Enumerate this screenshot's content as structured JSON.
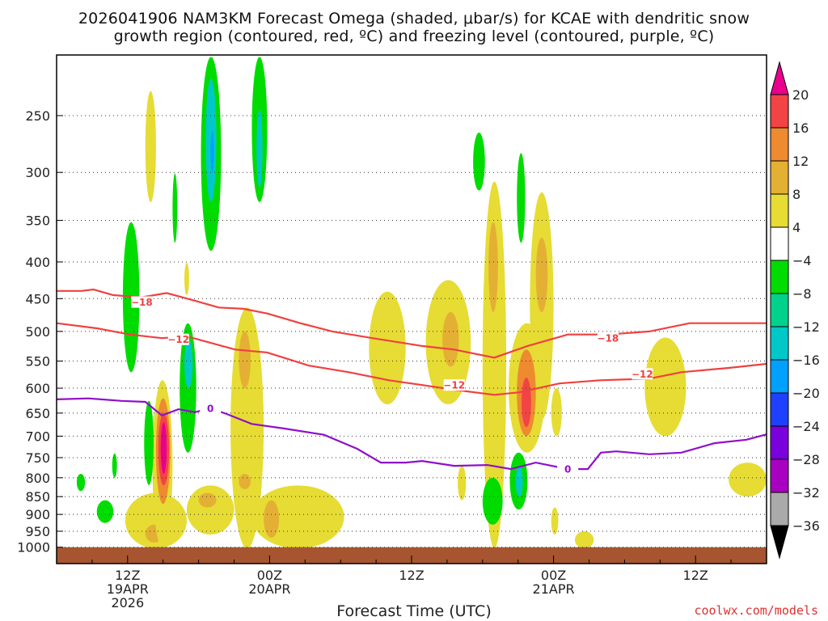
{
  "chart_data": {
    "type": "heatmap",
    "title_line1": "2026041906 NAM3KM Forecast Omega (shaded, μbar/s) for KCAE with dendritic snow",
    "title_line2": "growth region (contoured, red, ºC) and freezing level (contoured, purple, ºC)",
    "xlabel": "Forecast Time (UTC)",
    "ylabel": "",
    "xlim_hours": [
      0,
      60
    ],
    "ylim_hPa": [
      1050,
      205
    ],
    "y_ticks": [
      250,
      300,
      350,
      400,
      450,
      500,
      550,
      600,
      650,
      700,
      750,
      800,
      850,
      900,
      950,
      1000
    ],
    "x_ticks": [
      {
        "hour": 6,
        "lines": [
          "12Z",
          "19APR",
          "2026"
        ]
      },
      {
        "hour": 18,
        "lines": [
          "00Z",
          "20APR"
        ]
      },
      {
        "hour": 30,
        "lines": [
          "12Z"
        ]
      },
      {
        "hour": 42,
        "lines": [
          "00Z",
          "21APR"
        ]
      },
      {
        "hour": 54,
        "lines": [
          "12Z"
        ]
      }
    ],
    "grid": "horizontal dotted",
    "colorbar": {
      "labels": [
        "20",
        "16",
        "12",
        "8",
        "4",
        "−4",
        "−8",
        "−12",
        "−16",
        "−20",
        "−24",
        "−28",
        "−32",
        "−36"
      ],
      "levels": [
        20,
        16,
        12,
        8,
        4,
        -4,
        -8,
        -12,
        -16,
        -20,
        -24,
        -28,
        -32,
        -36
      ],
      "colors": [
        "#f24444",
        "#ee8a30",
        "#e4b034",
        "#e6dc34",
        "#ffffff",
        "#00dc00",
        "#00d28c",
        "#00c8c8",
        "#00a0ff",
        "#1e40ff",
        "#7a00dc",
        "#a800c0",
        "#aaaaaa"
      ],
      "over_color": "#e8008c",
      "under_color": "#000000"
    },
    "omega_blobs_hour_hPa_value": [
      [
        7.5,
        8.4,
        231,
        330,
        6
      ],
      [
        12.2,
        13.9,
        207,
        386,
        -6
      ],
      [
        12.6,
        13.5,
        222,
        330,
        -14
      ],
      [
        13.0,
        13.3,
        262,
        300,
        -18
      ],
      [
        16.5,
        17.8,
        207,
        330,
        -6
      ],
      [
        16.9,
        17.4,
        245,
        315,
        -12
      ],
      [
        9.8,
        10.2,
        301,
        376,
        -6
      ],
      [
        5.6,
        7.0,
        352,
        570,
        -6
      ],
      [
        10.8,
        11.2,
        401,
        445,
        6
      ],
      [
        10.4,
        11.8,
        487,
        738,
        -6
      ],
      [
        10.8,
        11.5,
        513,
        600,
        -14
      ],
      [
        14.7,
        17.5,
        463,
        1004,
        6
      ],
      [
        15.4,
        16.4,
        500,
        600,
        10
      ],
      [
        15.4,
        16.4,
        790,
        830,
        10
      ],
      [
        11.0,
        15.0,
        820,
        960,
        6
      ],
      [
        12.0,
        13.5,
        840,
        880,
        10
      ],
      [
        5.8,
        11.0,
        840,
        1004,
        6
      ],
      [
        7.5,
        9.0,
        930,
        985,
        10
      ],
      [
        16.5,
        24.3,
        820,
        1004,
        6
      ],
      [
        17.5,
        18.8,
        860,
        970,
        10
      ],
      [
        8.1,
        9.8,
        585,
        1004,
        6
      ],
      [
        8.4,
        9.6,
        620,
        870,
        14
      ],
      [
        8.6,
        9.5,
        650,
        820,
        18
      ],
      [
        8.8,
        9.3,
        670,
        790,
        22
      ],
      [
        7.4,
        8.2,
        625,
        819,
        -6
      ],
      [
        26.4,
        29.5,
        440,
        632,
        6
      ],
      [
        31.2,
        35.0,
        424,
        632,
        6
      ],
      [
        32.6,
        34.0,
        470,
        560,
        10
      ],
      [
        36.0,
        38.0,
        309,
        1004,
        6
      ],
      [
        36.5,
        37.3,
        352,
        470,
        10
      ],
      [
        40.0,
        42.0,
        320,
        664,
        6
      ],
      [
        40.5,
        41.5,
        370,
        470,
        10
      ],
      [
        35.2,
        36.2,
        264,
        318,
        -6
      ],
      [
        38.9,
        39.6,
        282,
        376,
        -6
      ],
      [
        38.2,
        41.3,
        487,
        738,
        6
      ],
      [
        38.9,
        40.5,
        530,
        700,
        14
      ],
      [
        39.3,
        40.1,
        580,
        680,
        18
      ],
      [
        38.3,
        39.8,
        738,
        886,
        -6
      ],
      [
        38.8,
        39.4,
        770,
        850,
        -14
      ],
      [
        36.0,
        37.7,
        800,
        930,
        -6
      ],
      [
        49.7,
        53.2,
        510,
        700,
        6
      ],
      [
        56.8,
        60.0,
        762,
        850,
        6
      ],
      [
        41.8,
        42.7,
        600,
        700,
        6
      ],
      [
        1.7,
        2.4,
        790,
        835,
        -6
      ],
      [
        3.4,
        4.8,
        860,
        925,
        -6
      ],
      [
        4.7,
        5.1,
        740,
        800,
        -6
      ],
      [
        33.9,
        34.6,
        770,
        860,
        6
      ],
      [
        43.8,
        45.4,
        950,
        1004,
        6
      ],
      [
        41.8,
        42.4,
        880,
        960,
        6
      ]
    ],
    "contours": [
      {
        "name": "dgz-top-minus18",
        "color": "#f04040",
        "label": "−18",
        "label_points": [
          [
            7.2,
            455
          ],
          [
            46.6,
            511
          ]
        ],
        "points": [
          [
            0,
            439
          ],
          [
            2.1,
            439
          ],
          [
            3.1,
            437
          ],
          [
            4.8,
            445
          ],
          [
            7.2,
            448
          ],
          [
            9.3,
            442
          ],
          [
            11.7,
            453
          ],
          [
            13.7,
            463
          ],
          [
            15.8,
            465
          ],
          [
            17.8,
            472
          ],
          [
            20.6,
            487
          ],
          [
            23.3,
            500
          ],
          [
            26.7,
            511
          ],
          [
            30.9,
            524
          ],
          [
            33.6,
            530
          ],
          [
            37.0,
            544
          ],
          [
            39.8,
            524
          ],
          [
            43.2,
            505
          ],
          [
            46.6,
            505
          ],
          [
            50.1,
            500
          ],
          [
            53.5,
            487
          ],
          [
            56.9,
            487
          ],
          [
            60,
            487
          ]
        ]
      },
      {
        "name": "dgz-bottom-minus12",
        "color": "#f04040",
        "label": "−12",
        "label_points": [
          [
            10.3,
            513
          ],
          [
            33.6,
            594
          ],
          [
            49.5,
            573
          ]
        ],
        "points": [
          [
            0,
            487
          ],
          [
            3.4,
            495
          ],
          [
            6.2,
            505
          ],
          [
            8.9,
            511
          ],
          [
            11.0,
            508
          ],
          [
            15.1,
            530
          ],
          [
            17.8,
            535
          ],
          [
            21.3,
            558
          ],
          [
            24.7,
            570
          ],
          [
            28.1,
            585
          ],
          [
            30.9,
            594
          ],
          [
            33.6,
            603
          ],
          [
            37.0,
            613
          ],
          [
            39.1,
            608
          ],
          [
            42.5,
            591
          ],
          [
            45.9,
            585
          ],
          [
            50.1,
            582
          ],
          [
            52.8,
            570
          ],
          [
            56.9,
            562
          ],
          [
            60,
            555
          ]
        ]
      },
      {
        "name": "freezing-level-0",
        "color": "#9010c8",
        "label": "0",
        "label_points": [
          [
            13.0,
            640
          ],
          [
            43.2,
            778
          ]
        ],
        "points": [
          [
            0,
            622
          ],
          [
            2.7,
            620
          ],
          [
            5.5,
            625
          ],
          [
            7.5,
            627
          ],
          [
            8.9,
            655
          ],
          [
            10.3,
            642
          ],
          [
            11.7,
            648
          ],
          [
            13.0,
            640
          ],
          [
            14.4,
            652
          ],
          [
            16.5,
            673
          ],
          [
            19.2,
            683
          ],
          [
            22.6,
            697
          ],
          [
            25.4,
            729
          ],
          [
            27.4,
            762
          ],
          [
            29.5,
            762
          ],
          [
            30.9,
            758
          ],
          [
            33.6,
            770
          ],
          [
            36.4,
            768
          ],
          [
            38.4,
            778
          ],
          [
            40.5,
            762
          ],
          [
            43.2,
            778
          ],
          [
            44.9,
            778
          ],
          [
            46.0,
            738
          ],
          [
            47.3,
            735
          ],
          [
            50.1,
            742
          ],
          [
            52.8,
            738
          ],
          [
            55.6,
            716
          ],
          [
            58.3,
            708
          ],
          [
            60,
            696
          ]
        ]
      }
    ],
    "terrain_color": "#a65530",
    "terrain_top_hPa": 1000
  },
  "footer": "coolwx.com/models"
}
